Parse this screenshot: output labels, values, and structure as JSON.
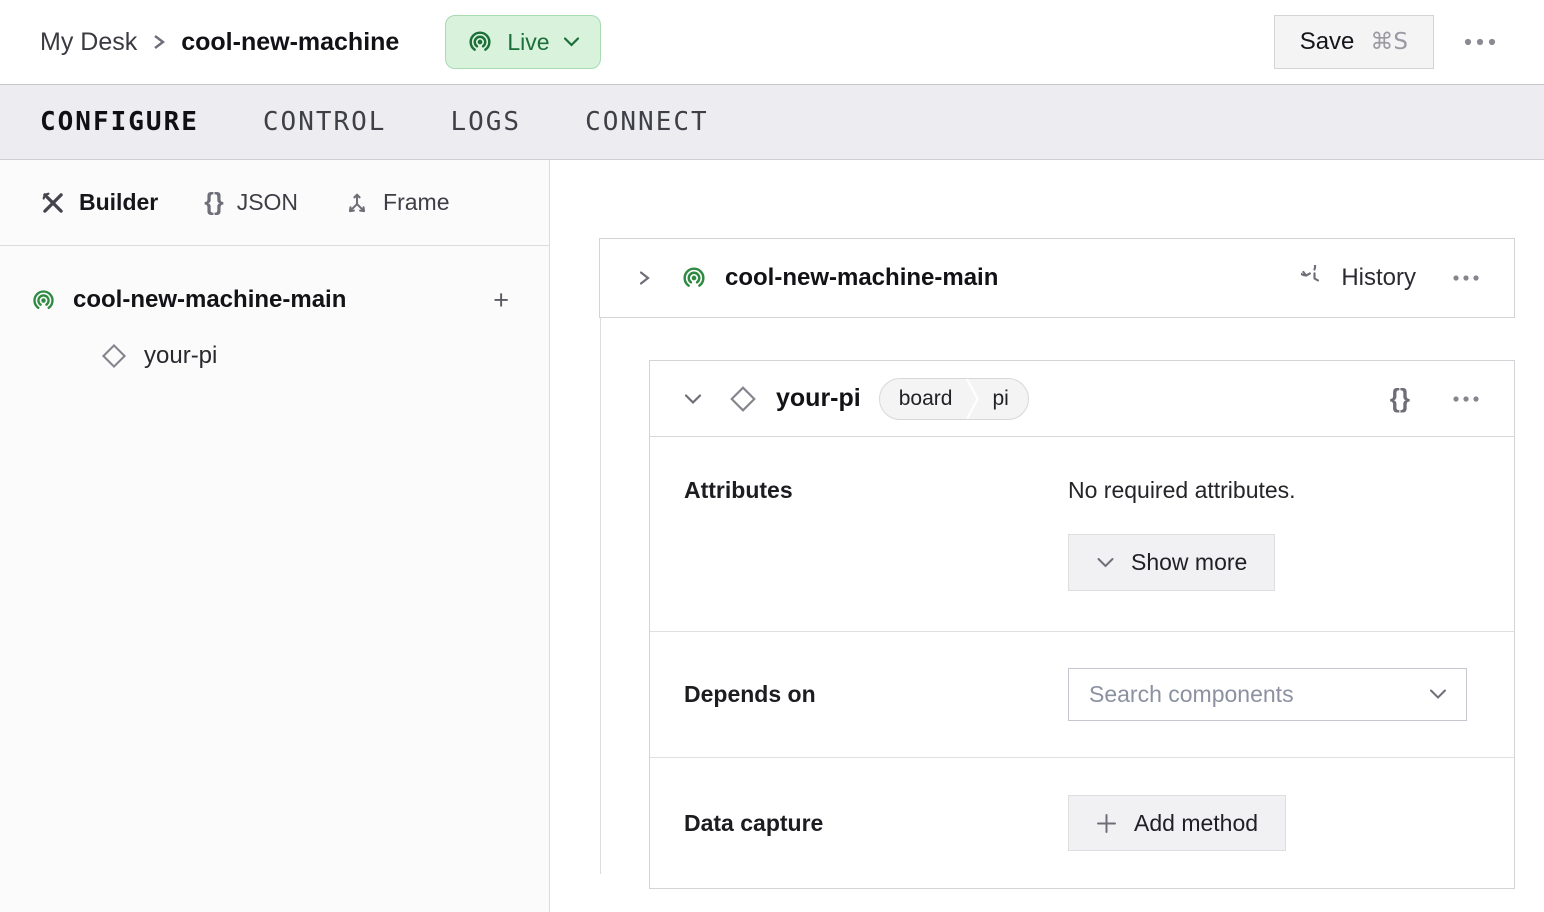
{
  "topbar": {
    "breadcrumb": {
      "parent": "My Desk",
      "current": "cool-new-machine"
    },
    "live_badge": {
      "label": "Live"
    },
    "save_button": {
      "label": "Save",
      "shortcut": "⌘S"
    }
  },
  "tabs": {
    "configure": "CONFIGURE",
    "control": "CONTROL",
    "logs": "LOGS",
    "connect": "CONNECT"
  },
  "sidebar": {
    "view_tabs": {
      "builder": "Builder",
      "json": "JSON",
      "frame": "Frame"
    },
    "tree": {
      "part": "cool-new-machine-main",
      "component": "your-pi",
      "add_label": "+"
    }
  },
  "main": {
    "part_card": {
      "title": "cool-new-machine-main",
      "history": "History"
    },
    "component_card": {
      "title": "your-pi",
      "type_badge": "board",
      "model_badge": "pi",
      "attributes": {
        "label": "Attributes",
        "empty": "No required attributes.",
        "show_more": "Show more"
      },
      "depends_on": {
        "label": "Depends on",
        "placeholder": "Search components"
      },
      "data_capture": {
        "label": "Data capture",
        "add_method": "Add method"
      }
    }
  },
  "icons": {
    "braces": "{}"
  },
  "colors": {
    "live_green": "#1b6f38",
    "live_badge_bg": "#d9f2dc",
    "live_badge_border": "#a6dcb0",
    "icon_green": "#2f8a41",
    "tabbar_bg": "#ececf1"
  }
}
